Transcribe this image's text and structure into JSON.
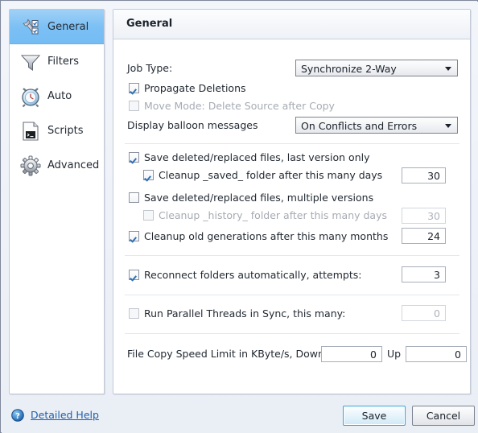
{
  "window": {
    "background": "#eef1f7",
    "accent": "#7cc0f4"
  },
  "sidebar": {
    "items": [
      {
        "label": "General",
        "icon": "wrench-checkbox-icon",
        "selected": true
      },
      {
        "label": "Filters",
        "icon": "funnel-icon",
        "selected": false
      },
      {
        "label": "Auto",
        "icon": "alarm-clock-icon",
        "selected": false
      },
      {
        "label": "Scripts",
        "icon": "script-document-icon",
        "selected": false
      },
      {
        "label": "Advanced",
        "icon": "gear-icon",
        "selected": false
      }
    ]
  },
  "panel": {
    "title": "General",
    "job_type": {
      "label": "Job Type:",
      "value": "Synchronize 2-Way",
      "options": [
        "Synchronize 2-Way"
      ]
    },
    "propagate_deletions": {
      "label": "Propagate Deletions",
      "checked": true,
      "enabled": true
    },
    "move_mode": {
      "label": "Move Mode: Delete Source after Copy",
      "checked": false,
      "enabled": false
    },
    "balloon": {
      "label": "Display balloon messages",
      "value": "On Conflicts and Errors",
      "options": [
        "On Conflicts and Errors"
      ]
    },
    "save_last_version": {
      "label": "Save deleted/replaced files, last version only",
      "checked": true,
      "enabled": true
    },
    "cleanup_saved": {
      "label": "Cleanup _saved_ folder after this many days",
      "checked": true,
      "enabled": true,
      "value": "30"
    },
    "save_multiple_versions": {
      "label": "Save deleted/replaced files, multiple versions",
      "checked": false,
      "enabled": true
    },
    "cleanup_history": {
      "label": "Cleanup _history_ folder after this many days",
      "checked": false,
      "enabled": false,
      "value": "30"
    },
    "cleanup_generations": {
      "label": "Cleanup old generations after this many months",
      "checked": true,
      "enabled": true,
      "value": "24"
    },
    "reconnect": {
      "label": "Reconnect folders automatically, attempts:",
      "checked": true,
      "enabled": true,
      "value": "3"
    },
    "parallel_threads": {
      "label": "Run Parallel Threads in Sync, this many:",
      "checked": false,
      "enabled": false,
      "value": "0"
    },
    "speed_limit": {
      "label": "File Copy Speed Limit in KByte/s, Down",
      "down_value": "0",
      "up_label": "Up",
      "up_value": "0"
    }
  },
  "footer": {
    "help_icon": "question-circle-icon",
    "help_label": "Detailed Help",
    "save_label": "Save",
    "cancel_label": "Cancel"
  }
}
